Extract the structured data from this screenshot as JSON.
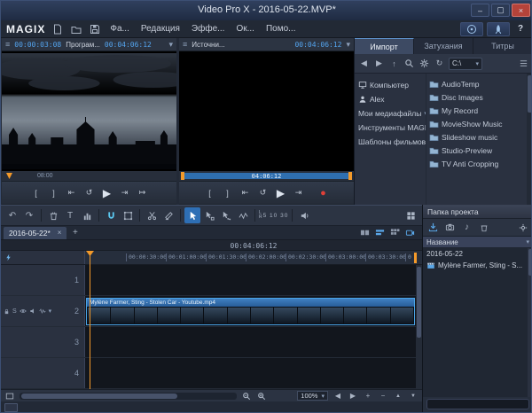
{
  "glyphs": {
    "minimize": "–",
    "maximize": "▢",
    "close": "×",
    "hamburger": "≡",
    "chevron": "▾",
    "undo": "↶",
    "redo": "↷",
    "title_tool": "T",
    "back": "◀",
    "forward": "▶",
    "up": "↑",
    "refresh": "↻",
    "plus": "+",
    "minus": "−",
    "help": "?",
    "tab_close": "×",
    "tab_add": "+",
    "note": "♪",
    "solo": "S",
    "left_ch": "L",
    "right_ch": "R",
    "record": "●",
    "scroll_up": "▲",
    "scroll_down": "▼",
    "sort": "▲"
  },
  "titlebar": {
    "title": "Video Pro X - 2016-05-22.MVP*"
  },
  "menubar": {
    "logo": "MAGIX",
    "menus": [
      "Фа...",
      "Редакция",
      "Эффе...",
      "Ок...",
      "Помо..."
    ]
  },
  "monitors": {
    "program": {
      "tc_current": "00:00:03:08",
      "title": "Програм...",
      "tc_total": "00:04:06:12",
      "ruler_label": "08:00"
    },
    "source": {
      "title": "Источни...",
      "tc_total": "00:04:06:12",
      "range_label": "04:06:12"
    },
    "transport": [
      "[",
      "]",
      "⇤",
      "↺",
      "▶",
      "⇥",
      "↦"
    ]
  },
  "import_panel": {
    "tabs": [
      "Импорт",
      "Затухания",
      "Титры"
    ],
    "path_value": "C:\\",
    "tree": [
      "Компьютер",
      "Alex",
      "Мои медиафайлы",
      "Инструменты MAGIX",
      "Шаблоны фильмов"
    ],
    "folders": [
      "AudioTemp",
      "Disc Images",
      "My Record",
      "MovieShow Music",
      "Slideshow music",
      "Studio-Preview",
      "TV Anti Cropping"
    ]
  },
  "project_panel": {
    "title": "Папка проекта",
    "column_header": "Название",
    "rows": [
      "2016-05-22",
      "Mylène Farmer, Sting - S..."
    ]
  },
  "timeline": {
    "tab": "2016-05-22*",
    "timecode": "00:04:06:12",
    "ruler_labels": [
      "00:00:30:00",
      "00:01:00:00",
      "00:01:30:00",
      "00:02:00:00",
      "00:02:30:00",
      "00:03:00:00",
      "00:03:30:00",
      "0"
    ],
    "snap_label": "5 10 30",
    "tracks": [
      "1",
      "2",
      "3",
      "4"
    ],
    "clip_title": "Mylène Farmer, Sting - Stolen Car - Youtube.mp4",
    "zoom": "100%"
  }
}
